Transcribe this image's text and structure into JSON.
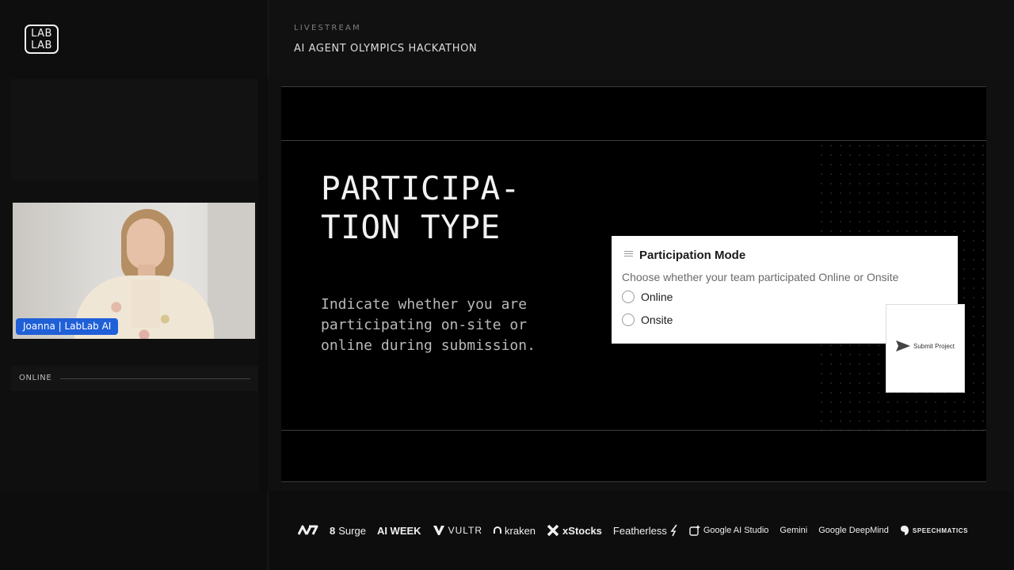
{
  "brand": {
    "logo_line1": "LAB",
    "logo_line2": "LAB"
  },
  "header": {
    "kicker": "LIVESTREAM",
    "title": "AI AGENT OLYMPICS HACKATHON"
  },
  "speaker": {
    "name_tag": "Joanna | LabLab AI"
  },
  "status": {
    "label": "ONLINE"
  },
  "slide": {
    "title_line1": "PARTICIPA-",
    "title_line2": "TION TYPE",
    "description": "Indicate whether you are participating on-site or online during submission."
  },
  "form": {
    "heading": "Participation Mode",
    "subtitle": "Choose whether your team participated Online or Onsite",
    "options": [
      {
        "label": "Online",
        "selected": false
      },
      {
        "label": "Onsite",
        "selected": false
      }
    ],
    "submit_label": "Submit Project"
  },
  "sponsors": [
    {
      "name": "",
      "icon": "nv-logo"
    },
    {
      "name": "Surge",
      "icon": "surge-logo"
    },
    {
      "name": "AI WEEK",
      "icon": ""
    },
    {
      "name": "VULTR",
      "icon": "vultr-logo"
    },
    {
      "name": "kraken",
      "icon": "kraken-logo"
    },
    {
      "name": "xStocks",
      "icon": "xstocks-logo"
    },
    {
      "name": "Featherless",
      "icon": "featherless-logo"
    },
    {
      "name": "Google AI Studio",
      "icon": "ai-studio-logo"
    },
    {
      "name": "Gemini",
      "icon": ""
    },
    {
      "name": "Google DeepMind",
      "icon": ""
    },
    {
      "name": "SPEECHMATICS",
      "icon": "speechmatics-logo"
    }
  ],
  "colors": {
    "name_tag": "#1f5fd8",
    "background": "#0c0c0c",
    "slide": "#000000"
  }
}
